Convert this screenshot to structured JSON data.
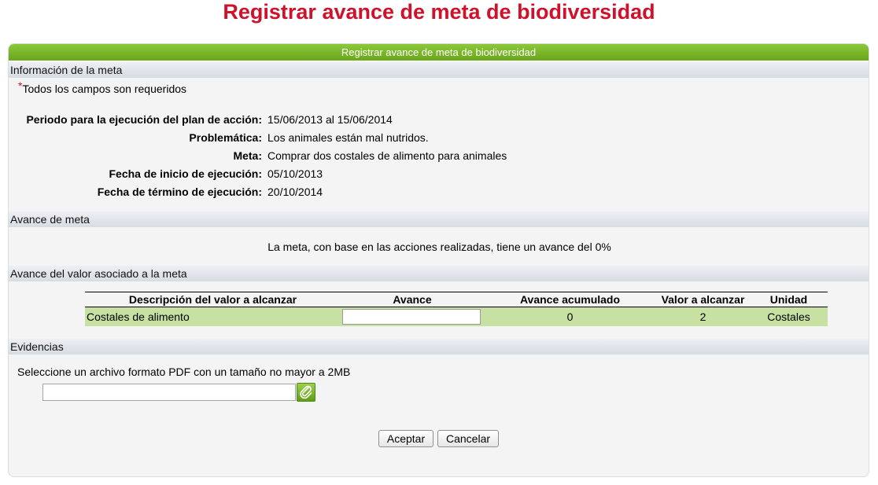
{
  "page": {
    "title": "Registrar avance de meta de biodiversidad"
  },
  "panel": {
    "header": "Registrar avance de meta de biodiversidad",
    "sections": {
      "info": "Información de la meta",
      "progress": "Avance de meta",
      "value_progress": "Avance del valor asociado a la meta",
      "evidence": "Evidencias"
    }
  },
  "info": {
    "required_star": "*",
    "required_note": "Todos los campos son requeridos",
    "fields": [
      {
        "label": "Periodo para la ejecución del plan de acción:",
        "value": "15/06/2013 al 15/06/2014"
      },
      {
        "label": "Problemática:",
        "value": "Los animales están mal nutridos."
      },
      {
        "label": "Meta:",
        "value": "Comprar dos costales de alimento para animales"
      },
      {
        "label": "Fecha de inicio de ejecución:",
        "value": "05/10/2013"
      },
      {
        "label": "Fecha de término de ejecución:",
        "value": "20/10/2014"
      }
    ]
  },
  "progress": {
    "text": "La meta, con base en las acciones realizadas, tiene un avance del 0%"
  },
  "table": {
    "headers": [
      "Descripción del valor a alcanzar",
      "Avance",
      "Avance acumulado",
      "Valor a alcanzar",
      "Unidad"
    ],
    "rows": [
      {
        "description": "Costales de alimento",
        "advance": "",
        "accumulated": "0",
        "target": "2",
        "unit": "Costales"
      }
    ]
  },
  "evidence": {
    "instruction": "Seleccione un archivo formato PDF con un tamaño no mayor a 2MB",
    "file_value": ""
  },
  "buttons": {
    "accept": "Aceptar",
    "cancel": "Cancelar"
  },
  "colors": {
    "title": "#d0112b",
    "header_green": "#6aa51c",
    "row_green": "#c7e1a3"
  },
  "icons": {
    "attach": "paperclip-icon"
  }
}
